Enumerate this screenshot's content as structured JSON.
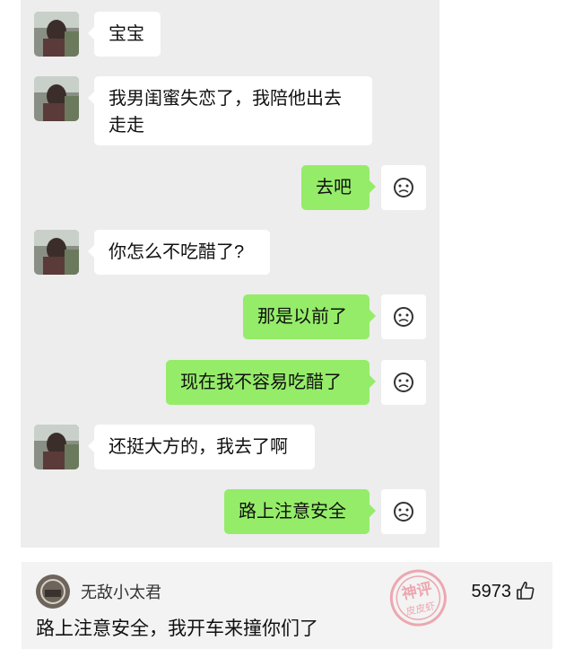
{
  "chat": {
    "messages": [
      {
        "side": "left",
        "text": "宝宝"
      },
      {
        "side": "left",
        "text": "我男闺蜜失恋了，我陪他出去走走"
      },
      {
        "side": "right",
        "text": "去吧"
      },
      {
        "side": "left",
        "text": "你怎么不吃醋了?"
      },
      {
        "side": "right",
        "text": "那是以前了"
      },
      {
        "side": "right",
        "text": "现在我不容易吃醋了"
      },
      {
        "side": "left",
        "text": "还挺大方的，我去了啊"
      },
      {
        "side": "right",
        "text": "路上注意安全"
      }
    ],
    "colors": {
      "background": "#ededed",
      "left_bubble": "#ffffff",
      "right_bubble": "#95ec69"
    }
  },
  "comment": {
    "username": "无敌小太君",
    "likes": "5973",
    "text": "路上注意安全，我开车来撞你们了",
    "icons": {
      "like": "thumbs-up-icon",
      "avatar": "user-avatar"
    }
  },
  "watermark": {
    "line1": "神评",
    "line2": "皮皮虾"
  }
}
